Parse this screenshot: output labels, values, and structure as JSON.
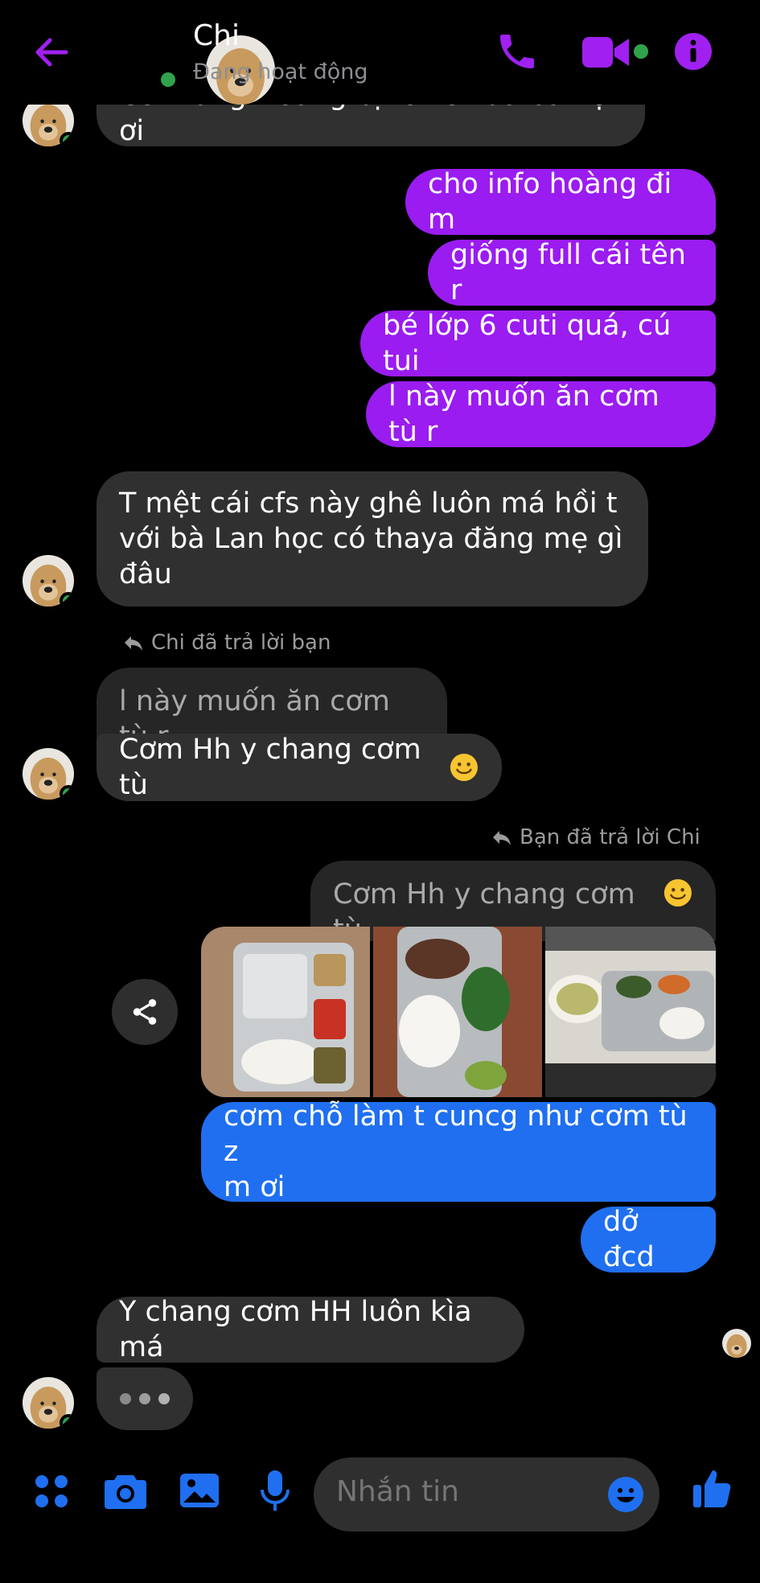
{
  "header": {
    "name": "Chi",
    "status": "Đang hoạt động"
  },
  "messages": {
    "m1": "Có thằng Hoàng bị toxic nữa bà nội ơi",
    "m2": "cho info hoàng đi m",
    "m3": "giống full cái tên r",
    "m4": "bé lớp 6 cuti quá, cú tui",
    "m5": "l này muốn ăn cơm tù r",
    "m6_line1": "T mệt cái cfs này ghê luôn má hồi t",
    "m6_line2": "với bà Lan học có thaya đăng mẹ gì",
    "m6_line3": "đâu",
    "reply1_note": "Chi đã trả lời bạn",
    "reply1_quote": "l này muốn ăn cơm tù r",
    "reply1_text": "Cơm Hh y chang cơm tù",
    "reply2_note": "Bạn đã trả lời Chi",
    "reply2_quote": "Cơm Hh y chang cơm tù",
    "m7_line1": "cơm chỗ làm t cuncg như cơm tù z",
    "m7_line2": "m ơi",
    "m8": "dở đcd",
    "m9": "Y chang cơm HH luôn kìa má"
  },
  "composer": {
    "placeholder": "Nhắn tin"
  },
  "colors": {
    "accent": "#9a1cf0",
    "blue": "#1f6ff0",
    "incoming": "#303030",
    "online": "#31a24c"
  }
}
